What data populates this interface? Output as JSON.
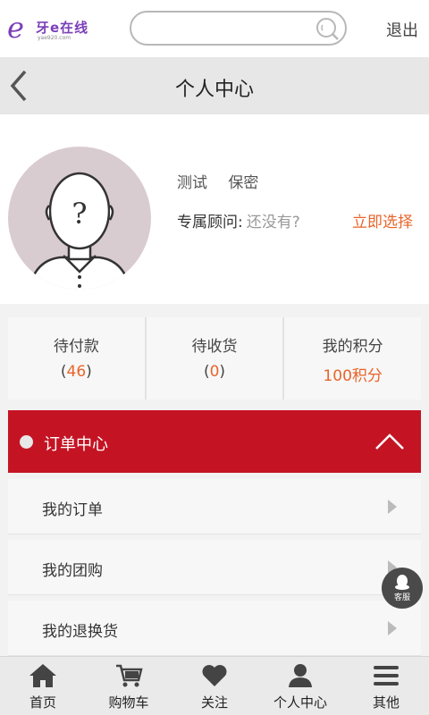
{
  "topbar": {
    "logo_mark": "e",
    "logo_text": "牙e在线",
    "logo_sub": "yae920.com",
    "search_value": "",
    "search_placeholder": "",
    "logout_label": "退出"
  },
  "header": {
    "title": "个人中心"
  },
  "profile": {
    "name": "测试",
    "privacy": "保密",
    "advisor_label": "专属顾问:",
    "advisor_value": "还没有?",
    "advisor_action": "立即选择"
  },
  "stats": [
    {
      "label": "待付款",
      "open": "(",
      "value": "46",
      "close": ")"
    },
    {
      "label": "待收货",
      "open": "(",
      "value": "0",
      "close": ")"
    },
    {
      "label": "我的积分",
      "open": "",
      "value": "100积分",
      "close": ""
    }
  ],
  "order_center": {
    "title": "订单中心",
    "items": [
      {
        "label": "我的订单"
      },
      {
        "label": "我的团购"
      },
      {
        "label": "我的退换货"
      }
    ]
  },
  "service": {
    "label": "客服"
  },
  "bottom_nav": [
    {
      "label": "首页",
      "icon": "home-icon"
    },
    {
      "label": "购物车",
      "icon": "cart-icon"
    },
    {
      "label": "关注",
      "icon": "heart-icon"
    },
    {
      "label": "个人中心",
      "icon": "user-icon"
    },
    {
      "label": "其他",
      "icon": "menu-icon"
    }
  ],
  "colors": {
    "accent_red": "#c41424",
    "highlight_orange": "#e8642a",
    "logo_purple": "#7b3fb8"
  }
}
